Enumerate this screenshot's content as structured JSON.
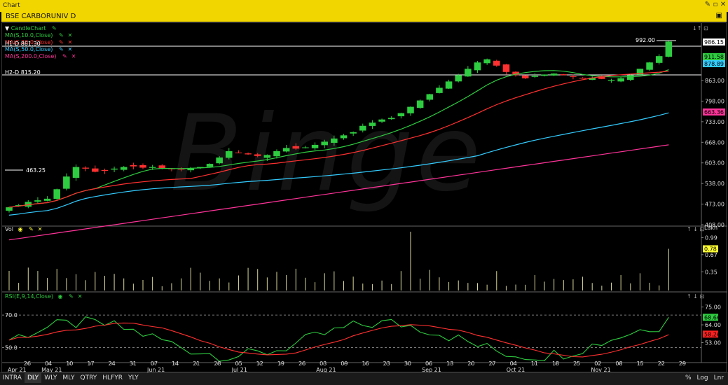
{
  "window": {
    "title": "Chart"
  },
  "symbol": {
    "label": "BSE CARBORUNIV D"
  },
  "panels": {
    "price": {
      "title": "CandleChart",
      "legend": [
        {
          "label": "MA(S,10.0,Close)",
          "color": "#2ecc40"
        },
        {
          "label": "MA(S,20.0,Close)",
          "color": "#ff3030"
        },
        {
          "label": "MA(S,50.0,Close)",
          "color": "#33ccff"
        },
        {
          "label": "MA(S,200.0,Close)",
          "color": "#ff3399"
        }
      ],
      "h1": "H1-D 861.30",
      "h2": "H2-D 815.20",
      "high_label": "992.00",
      "low_label": "463.25",
      "yticks": [
        "863.00",
        "798.00",
        "733.00",
        "668.00",
        "603.00",
        "538.00",
        "473.00",
        "408.00"
      ],
      "badges": [
        {
          "label": "986.15",
          "bg": "#ffffff",
          "fg": "#000000"
        },
        {
          "label": "911.58",
          "bg": "#2ecc40",
          "fg": "#000000"
        },
        {
          "label": "878.89",
          "bg": "#33ccff",
          "fg": "#000000"
        },
        {
          "label": "663.36",
          "bg": "#ff3399",
          "fg": "#000000"
        }
      ]
    },
    "volume": {
      "title": "Vol",
      "unit": "Lakh",
      "yticks": [
        "0.99",
        "0.67",
        "0.35"
      ],
      "badge": {
        "label": "0.78",
        "bg": "#ffff33",
        "fg": "#000000"
      }
    },
    "rsi": {
      "title": "RSI(E,9,14,Close)",
      "level_hi": "70.0",
      "level_lo": "50.0",
      "yticks": [
        "75.00",
        "64.00",
        "53.00"
      ],
      "badges": [
        {
          "label": "68.66",
          "bg": "#2ecc40",
          "fg": "#000000"
        },
        {
          "label": "58.26",
          "bg": "#ff2020",
          "fg": "#000000"
        }
      ]
    }
  },
  "xaxis": {
    "ticks": [
      "26",
      "04",
      "10",
      "17",
      "24",
      "31",
      "07",
      "14",
      "21",
      "28",
      "05",
      "12",
      "19",
      "26",
      "03",
      "09",
      "16",
      "23",
      "30",
      "06",
      "13",
      "20",
      "27",
      "04",
      "11",
      "18",
      "25",
      "02",
      "08",
      "15",
      "22",
      "29"
    ],
    "months": [
      "Apr 21",
      "May 21",
      "Jun 21",
      "Jul 21",
      "Aug 21",
      "Sep 21",
      "Oct 21",
      "Nov 21"
    ]
  },
  "bottom": {
    "tabs": [
      "INTRA",
      "DLY",
      "WLY",
      "MLY",
      "QTRY",
      "HLFYR",
      "YLY"
    ],
    "active": "DLY",
    "right": [
      "%",
      "Log",
      "Lnr"
    ]
  },
  "watermark": "Binge",
  "chart_data": {
    "type": "candlestick",
    "title": "BSE CARBORUNIV D",
    "ylim": [
      408,
      1000
    ],
    "series": [
      {
        "name": "Close",
        "values": [
          463,
          470,
          480,
          485,
          490,
          520,
          560,
          590,
          585,
          575,
          578,
          585,
          590,
          592,
          588,
          590,
          586,
          584,
          582,
          585,
          590,
          600,
          620,
          640,
          635,
          630,
          625,
          628,
          640,
          650,
          648,
          652,
          660,
          670,
          680,
          690,
          700,
          720,
          730,
          740,
          745,
          760,
          780,
          800,
          820,
          840,
          860,
          880,
          900,
          920,
          930,
          910,
          890,
          880,
          870,
          878,
          882,
          885,
          880,
          875,
          870,
          872,
          868,
          865,
          870,
          880,
          900,
          920,
          940,
          986
        ]
      },
      {
        "name": "MA(S,10.0,Close)",
        "values": []
      },
      {
        "name": "MA(S,20.0,Close)",
        "values": []
      },
      {
        "name": "MA(S,50.0,Close)",
        "values": []
      },
      {
        "name": "MA(S,200.0,Close)",
        "values": []
      }
    ],
    "annotations": [
      "992.00",
      "463.25",
      "H1-D 861.30",
      "H2-D 815.20"
    ]
  }
}
